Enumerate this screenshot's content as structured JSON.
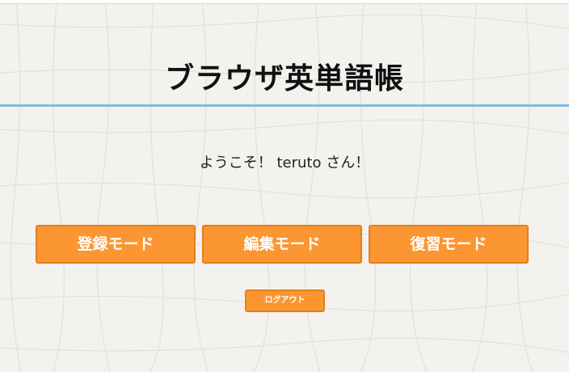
{
  "header": {
    "title": "ブラウザ英単語帳"
  },
  "main": {
    "welcome": "ようこそ！ teruto さん！",
    "modes": {
      "register": "登録モード",
      "edit": "編集モード",
      "review": "復習モード"
    },
    "logout": "ログアウト"
  },
  "colors": {
    "accent": "#fb9632",
    "accent_border": "#e67e1a",
    "header_line": "#7dbde0",
    "background": "#f4f2ee"
  }
}
